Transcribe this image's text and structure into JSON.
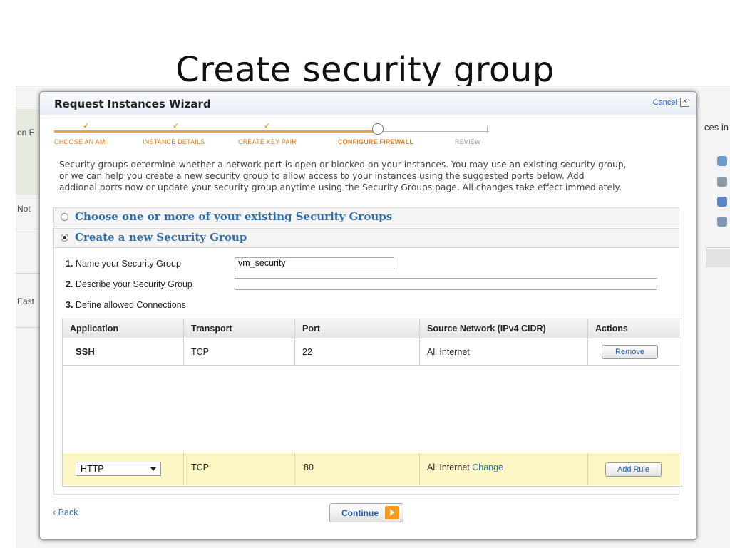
{
  "slide": {
    "title": "Create security group"
  },
  "background": {
    "left_labels": [
      "on E",
      "Not",
      "East"
    ],
    "right_text": "ces in"
  },
  "wizard": {
    "title": "Request Instances Wizard",
    "cancel_label": "Cancel",
    "cancel_icon": "close-icon",
    "steps": [
      {
        "label": "CHOOSE AN AMI",
        "state": "done"
      },
      {
        "label": "INSTANCE DETAILS",
        "state": "done"
      },
      {
        "label": "CREATE KEY PAIR",
        "state": "done"
      },
      {
        "label": "CONFIGURE FIREWALL",
        "state": "active"
      },
      {
        "label": "REVIEW",
        "state": "todo"
      }
    ],
    "check_glyph": "✓",
    "intro_line1": "Security groups determine whether a network port is open or blocked on your instances. You may use an existing security group,",
    "intro_line2": "or we can help you create a new security group to allow access to your instances using the suggested ports below. Add",
    "intro_line3": "addional ports now or update your security group anytime using the Security Groups page. All changes take effect immediately.",
    "existing_group_label": "Choose one or more of your existing Security Groups",
    "new_group_label": "Create a new Security Group",
    "form": {
      "name_num": "1.",
      "name_label": "Name your Security Group",
      "name_value": "vm_security",
      "desc_num": "2.",
      "desc_label": "Describe your Security Group",
      "desc_value": "",
      "conn_num": "3.",
      "conn_label": "Define allowed Connections"
    },
    "table": {
      "headers": [
        "Application",
        "Transport",
        "Port",
        "Source Network (IPv4 CIDR)",
        "Actions"
      ],
      "rows": [
        {
          "application": "SSH",
          "transport": "TCP",
          "port": "22",
          "source": "All Internet",
          "action": "Remove"
        }
      ],
      "new_rule": {
        "application": "HTTP",
        "transport": "TCP",
        "port": "80",
        "source": "All Internet",
        "change_label": "Change",
        "action": "Add Rule"
      }
    },
    "back_label": "Back",
    "back_glyph": "‹",
    "continue_label": "Continue"
  },
  "colors": {
    "accent_orange": "#f49b1f",
    "link_blue": "#2f6da8",
    "new_rule_bg": "#fcf6c4"
  }
}
